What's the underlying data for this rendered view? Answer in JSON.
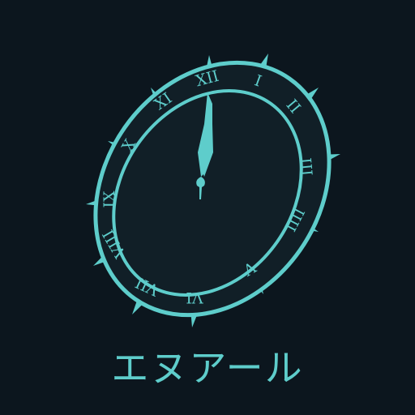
{
  "title": "エヌアール",
  "colors": {
    "background": "#0c161e",
    "accent": "#5ecdcb",
    "face": "#111f27"
  },
  "clock": {
    "numerals": [
      "XII",
      "I",
      "II",
      "III",
      "IIII",
      "V",
      "VI",
      "VII",
      "VIII",
      "IX",
      "X",
      "XI"
    ],
    "time_shown": "12:00"
  }
}
